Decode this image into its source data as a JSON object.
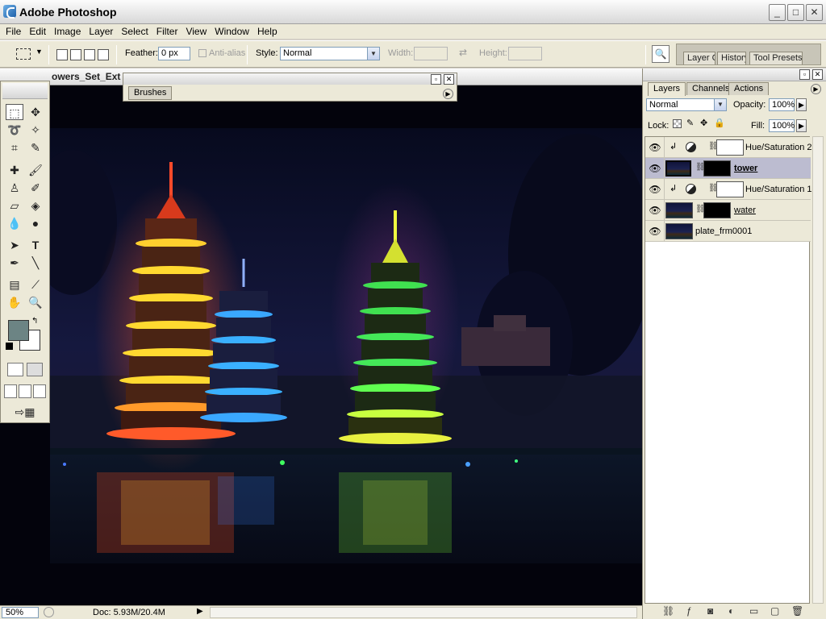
{
  "window": {
    "title": "Adobe Photoshop",
    "minimize": "_",
    "maximize": "□",
    "close": "✕"
  },
  "menu": [
    "File",
    "Edit",
    "Image",
    "Layer",
    "Select",
    "Filter",
    "View",
    "Window",
    "Help"
  ],
  "options": {
    "feather_label": "Feather:",
    "feather_value": "0 px",
    "antialias_label": "Anti-alias",
    "style_label": "Style:",
    "style_value": "Normal",
    "width_label": "Width:",
    "height_label": "Height:"
  },
  "palette_well": {
    "tabs": [
      "Layer C",
      "History",
      "Tool Presets"
    ]
  },
  "document": {
    "title": "owers_Set_Ext"
  },
  "brushes": {
    "tab": "Brushes"
  },
  "colors": {
    "foreground": "#6c8484",
    "background": "#ffffff"
  },
  "layers_panel": {
    "tabs": [
      "Layers",
      "Channels",
      "Actions"
    ],
    "active_tab": "Layers",
    "blend_mode": "Normal",
    "opacity_label": "Opacity:",
    "opacity_value": "100%",
    "lock_label": "Lock:",
    "fill_label": "Fill:",
    "fill_value": "100%",
    "layers": [
      {
        "name": "Hue/Saturation 2",
        "type": "adjustment",
        "visible": true,
        "clipped": true
      },
      {
        "name": "tower",
        "type": "image",
        "visible": true,
        "selected": true
      },
      {
        "name": "Hue/Saturation 1",
        "type": "adjustment",
        "visible": true,
        "clipped": true
      },
      {
        "name": "water",
        "type": "image",
        "visible": true
      },
      {
        "name": "plate_frm0001",
        "type": "image",
        "visible": true
      }
    ]
  },
  "status": {
    "zoom": "50%",
    "doc_size": "Doc: 5.93M/20.4M"
  }
}
